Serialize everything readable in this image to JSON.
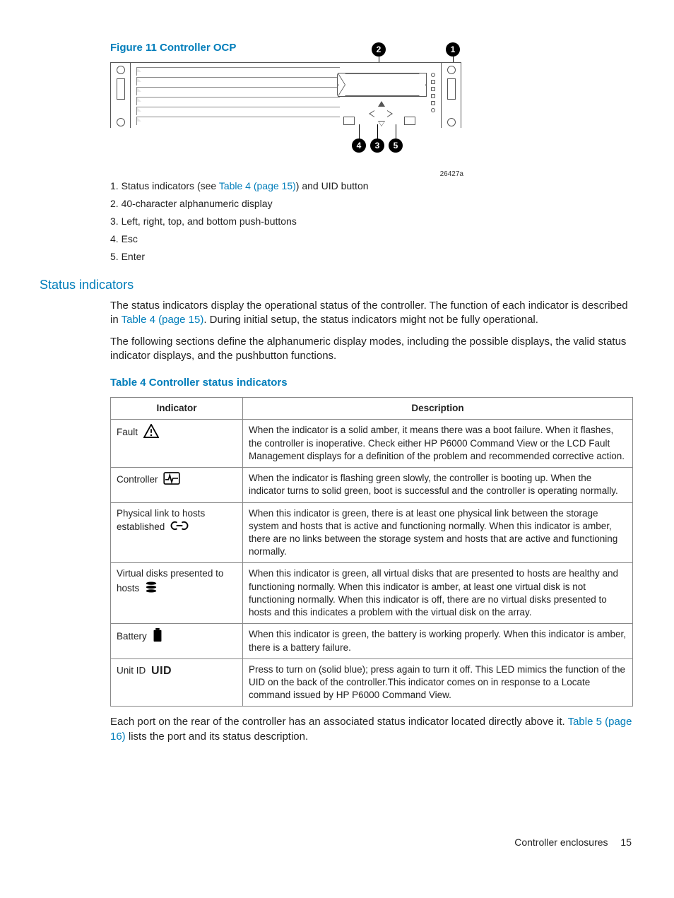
{
  "figure": {
    "caption": "Figure 11 Controller OCP",
    "code": "26427a",
    "bubbles": [
      "1",
      "2",
      "3",
      "4",
      "5"
    ],
    "callouts": [
      {
        "prefix": "1. Status indicators (see ",
        "link": "Table 4 (page 15)",
        "suffix": ") and UID button"
      },
      {
        "prefix": "2. 40-character alphanumeric display",
        "link": "",
        "suffix": ""
      },
      {
        "prefix": "3. Left, right, top, and bottom push-buttons",
        "link": "",
        "suffix": ""
      },
      {
        "prefix": "4. Esc",
        "link": "",
        "suffix": ""
      },
      {
        "prefix": "5. Enter",
        "link": "",
        "suffix": ""
      }
    ]
  },
  "section": {
    "heading": "Status indicators",
    "para1a": "The status indicators display the operational status of the controller. The function of each indicator is described in ",
    "para1link": "Table 4 (page 15)",
    "para1b": ". During initial setup, the status indicators might not be fully operational.",
    "para2": "The following sections define the alphanumeric display modes, including the possible displays, the valid status indicator displays, and the pushbutton functions."
  },
  "table": {
    "caption": "Table 4 Controller status indicators",
    "headers": [
      "Indicator",
      "Description"
    ],
    "rows": [
      {
        "indicator": "Fault",
        "icon": "fault",
        "description": "When the indicator is a solid amber, it means there was a boot failure. When it flashes, the controller is inoperative. Check either HP P6000 Command View or the LCD Fault Management displays for a definition of the problem and recommended corrective action."
      },
      {
        "indicator": "Controller",
        "icon": "heartbeat",
        "description": "When the indicator is flashing green slowly, the controller is booting up. When the indicator turns to solid green, boot is successful and the controller is operating normally."
      },
      {
        "indicator": "Physical link to hosts established",
        "icon": "link",
        "description": "When this indicator is green, there is at least one physical link between the storage system and hosts that is active and functioning normally. When this indicator is amber, there are no links between the storage system and hosts that are active and functioning normally."
      },
      {
        "indicator": "Virtual disks presented to hosts",
        "icon": "disks",
        "description": "When this indicator is green, all virtual disks that are presented to hosts are healthy and functioning normally. When this indicator is amber, at least one virtual disk is not functioning normally. When this indicator is off, there are no virtual disks presented to hosts and this indicates a problem with the virtual disk on the array."
      },
      {
        "indicator": "Battery",
        "icon": "battery",
        "description": "When this indicator is green, the battery is working properly. When this indicator is amber, there is a battery failure."
      },
      {
        "indicator": "Unit ID",
        "icon": "uid",
        "uid_label": "UID",
        "description": "Press to turn on (solid blue); press again to turn it off. This LED mimics the function of the UID on the back of the controller.This indicator comes on in response to a Locate command issued by HP P6000 Command View."
      }
    ]
  },
  "tail": {
    "text_a": "Each port on the rear of the controller has an associated status indicator located directly above it. ",
    "link": "Table 5 (page 16)",
    "text_b": " lists the port and its status description."
  },
  "footer": {
    "section": "Controller enclosures",
    "page": "15"
  }
}
